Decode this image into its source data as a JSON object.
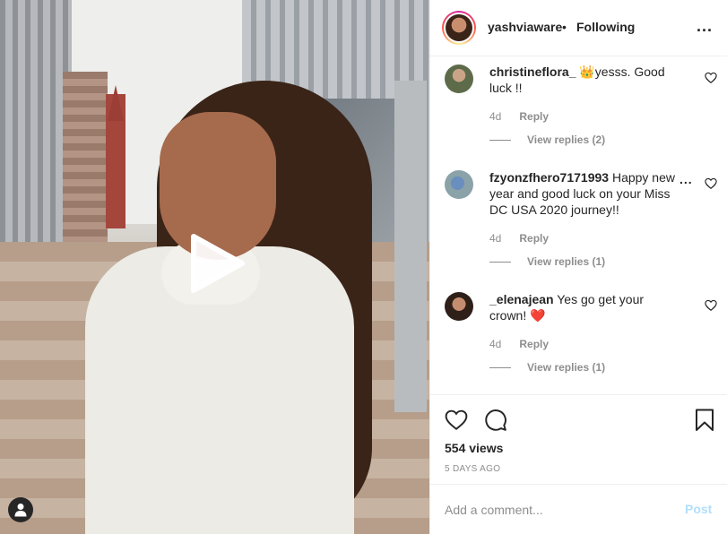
{
  "header": {
    "username": "yashviaware",
    "separator": "•",
    "follow_status": "Following",
    "more_label": "..."
  },
  "media": {
    "type": "video",
    "play_icon": "play-icon",
    "user_tag_icon": "user-icon"
  },
  "comments": [
    {
      "username": "christineflora_",
      "text": " 👑yesss. Good luck !!",
      "age": "4d",
      "reply_label": "Reply",
      "view_replies": "View replies (2)",
      "heart_icon": "heart-outline-icon"
    },
    {
      "username": "fzyonzfhero7171993",
      "text": " Happy new year and good luck on your Miss DC USA 2020 journey!!",
      "age": "4d",
      "reply_label": "Reply",
      "view_replies": "View replies (1)",
      "more_label": "...",
      "heart_icon": "heart-outline-icon"
    },
    {
      "username": "_elenajean",
      "text": " Yes go get your crown! ❤️",
      "age": "4d",
      "reply_label": "Reply",
      "view_replies": "View replies (1)",
      "heart_icon": "heart-outline-icon"
    }
  ],
  "actions": {
    "like_icon": "heart-outline-icon",
    "comment_icon": "comment-icon",
    "save_icon": "bookmark-icon",
    "views": "554 views",
    "posted": "5 DAYS AGO"
  },
  "add_comment": {
    "placeholder": "Add a comment...",
    "post_label": "Post"
  },
  "colors": {
    "text": "#262626",
    "secondary": "#8e8e8e",
    "border": "#efefef",
    "post_disabled": "#b2dffc"
  }
}
